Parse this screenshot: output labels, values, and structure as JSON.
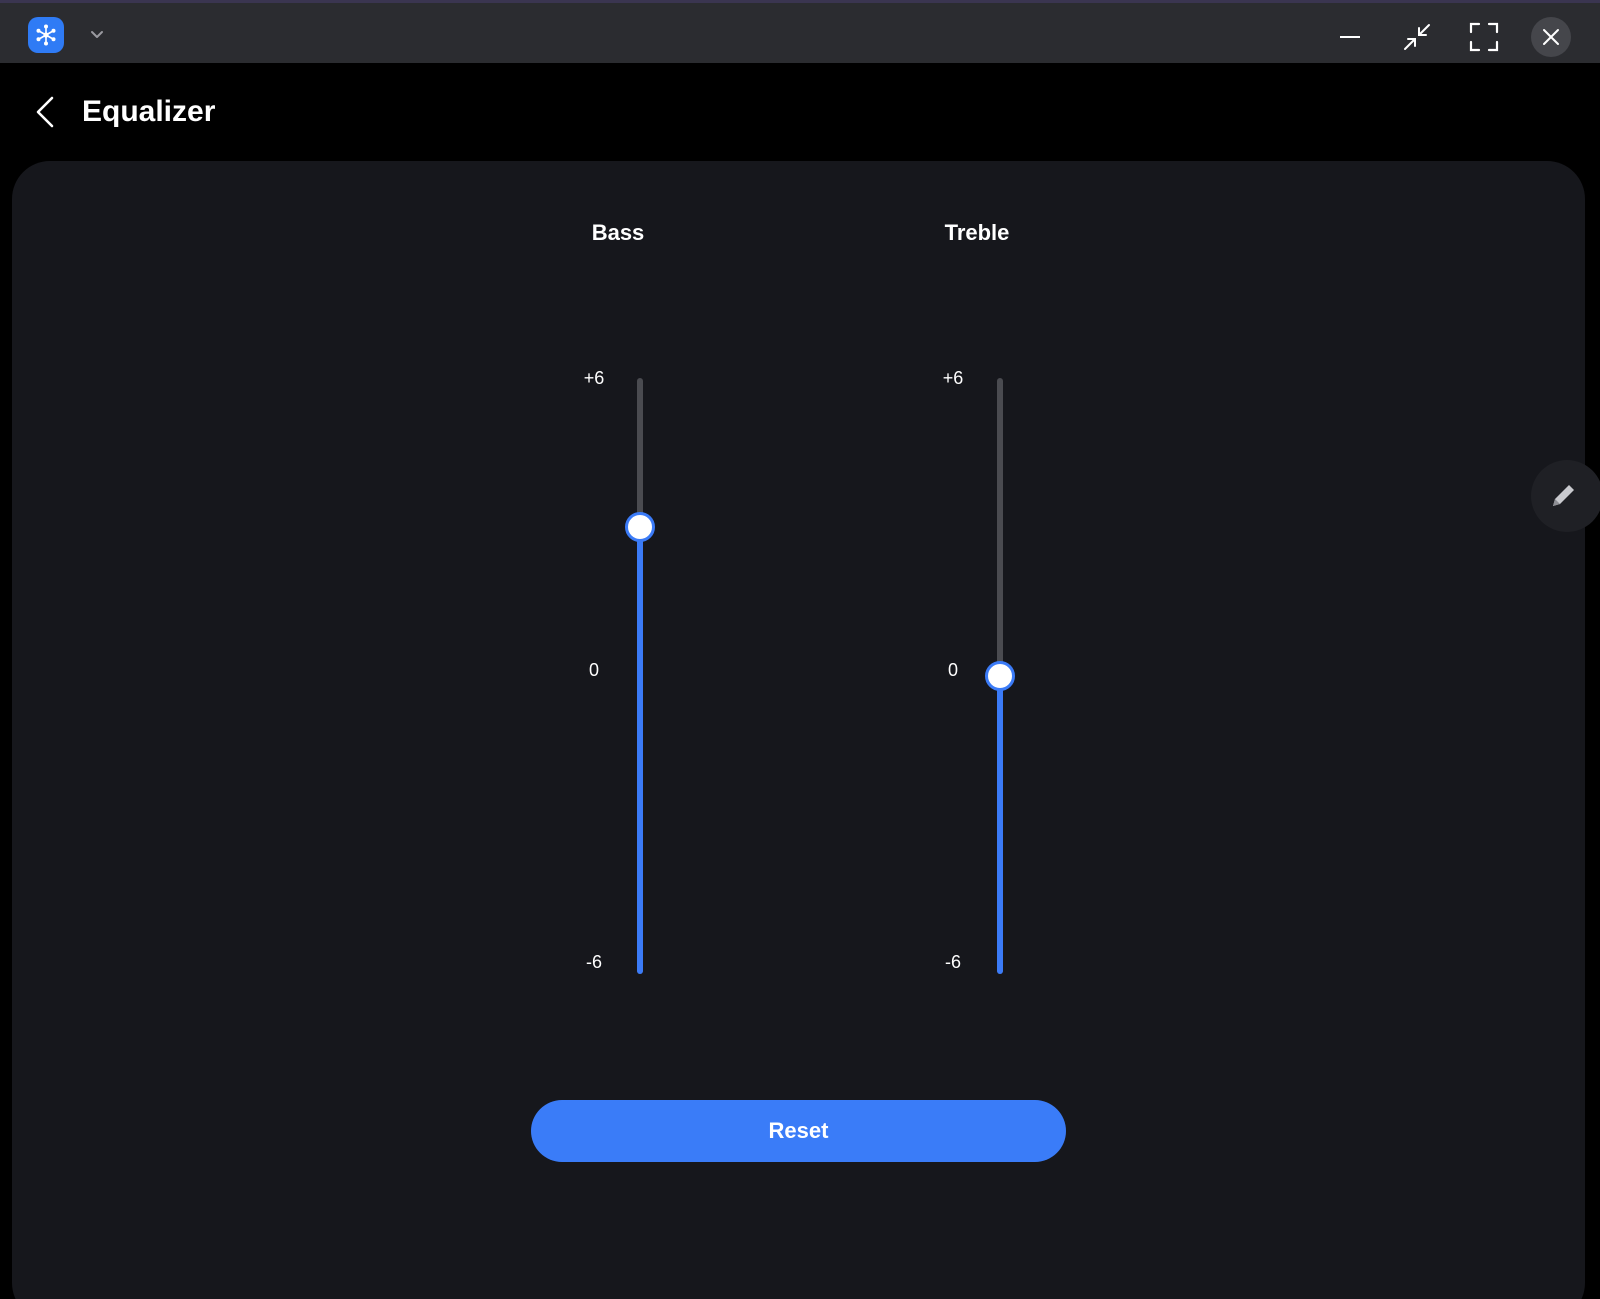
{
  "header": {
    "title": "Equalizer"
  },
  "equalizer": {
    "range_max": 6,
    "range_min": -6,
    "bands": [
      {
        "label": "Bass",
        "value": 3,
        "ticks": {
          "top": "+6",
          "mid": "0",
          "bottom": "-6"
        }
      },
      {
        "label": "Treble",
        "value": 0,
        "ticks": {
          "top": "+6",
          "mid": "0",
          "bottom": "-6"
        }
      }
    ]
  },
  "actions": {
    "reset_label": "Reset"
  },
  "icons": {
    "app": "app-network-icon",
    "chevron": "chevron-down-icon",
    "minimize": "minimize-icon",
    "restore": "restore-icon",
    "fullscreen": "fullscreen-icon",
    "close": "close-icon",
    "back": "back-arrow-icon",
    "edit": "pencil-icon"
  },
  "colors": {
    "accent": "#3a7cf8",
    "panel": "#16171c",
    "track": "#4a4b50",
    "titlebar": "#2b2c30"
  }
}
